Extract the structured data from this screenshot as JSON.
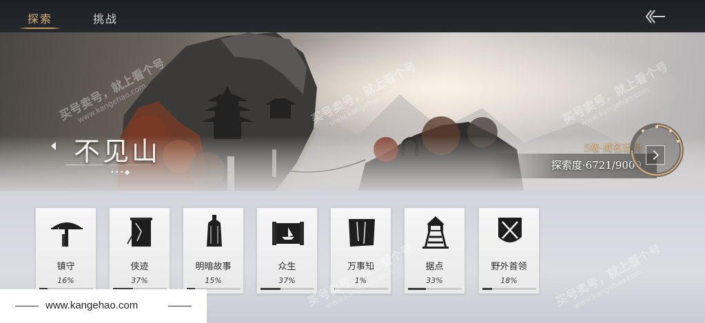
{
  "tabs": [
    {
      "label": "探索",
      "active": true
    },
    {
      "label": "挑战",
      "active": false
    }
  ],
  "banner": {
    "region_name": "不见山",
    "dots": "•••◆",
    "level": "5级·威名远扬",
    "progress_label": "探索度·6721/9000",
    "progress_current": 6721,
    "progress_total": 9000
  },
  "cards": [
    {
      "label": "镇守",
      "percent_text": "16%",
      "percent": 16,
      "icon": "umbrella-hat-icon"
    },
    {
      "label": "侠迹",
      "percent_text": "37%",
      "percent": 37,
      "icon": "scroll-banner-icon"
    },
    {
      "label": "明暗故事",
      "percent_text": "15%",
      "percent": 15,
      "icon": "bell-icon"
    },
    {
      "label": "众生",
      "percent_text": "37%",
      "percent": 37,
      "icon": "scroll-boat-icon"
    },
    {
      "label": "万事知",
      "percent_text": "1%",
      "percent": 1,
      "icon": "torn-map-icon"
    },
    {
      "label": "据点",
      "percent_text": "33%",
      "percent": 33,
      "icon": "watchtower-icon"
    },
    {
      "label": "野外首领",
      "percent_text": "18%",
      "percent": 18,
      "icon": "crossed-swords-shield-icon"
    }
  ],
  "watermark": {
    "text": "买号卖号，就上看个号",
    "url": "www.kangehao.com",
    "small": "看个号"
  },
  "site_label": "www.kangehao.com",
  "colors": {
    "accent_gold": "#d8b07a",
    "topbar": "#1d2126",
    "card_bg": "#f6f6f6"
  }
}
